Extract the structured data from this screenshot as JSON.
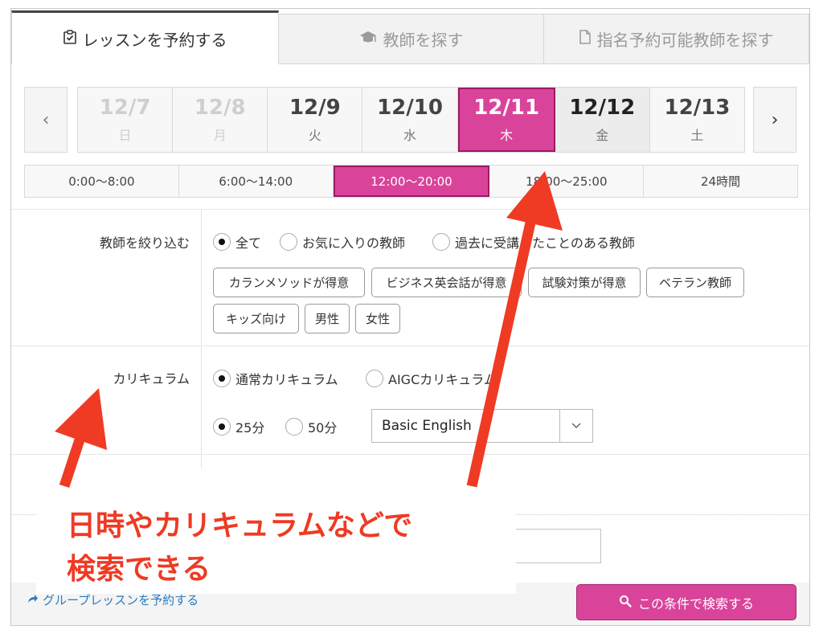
{
  "tabs": [
    {
      "label": "レッスンを予約する",
      "icon": "clipboard-check-icon"
    },
    {
      "label": "教師を探す",
      "icon": "graduation-cap-icon"
    },
    {
      "label": "指名予約可能教師を探す",
      "icon": "document-icon"
    }
  ],
  "nav": {
    "prev": "‹",
    "next": "›"
  },
  "dates": [
    {
      "date": "12/7",
      "weekday": "日"
    },
    {
      "date": "12/8",
      "weekday": "月"
    },
    {
      "date": "12/9",
      "weekday": "火"
    },
    {
      "date": "12/10",
      "weekday": "水"
    },
    {
      "date": "12/11",
      "weekday": "木"
    },
    {
      "date": "12/12",
      "weekday": "金"
    },
    {
      "date": "12/13",
      "weekday": "土"
    }
  ],
  "selected_date": "12/11",
  "time_slots": [
    "0:00〜8:00",
    "6:00〜14:00",
    "12:00〜20:00",
    "18:00〜25:00",
    "24時間"
  ],
  "selected_time_slot": "12:00〜20:00",
  "teacher_filter": {
    "label": "教師を絞り込む",
    "options": [
      "全て",
      "お気に入りの教師",
      "過去に受講したことのある教師"
    ],
    "selected": "全て",
    "tags": [
      "カランメソッドが得意",
      "ビジネス英会話が得意",
      "試験対策が得意",
      "ベテラン教師",
      "キッズ向け",
      "男性",
      "女性"
    ]
  },
  "curriculum": {
    "label": "カリキュラム",
    "options": [
      "通常カリキュラム",
      "AIGCカリキュラム"
    ],
    "selected": "通常カリキュラム",
    "durations": [
      "25分",
      "50分"
    ],
    "selected_duration": "25分",
    "course": "Basic English"
  },
  "annotation": {
    "line1": "日時やカリキュラムなどで",
    "line2": "検索できる",
    "color": "#ef3a24"
  },
  "footer": {
    "group_link": "グループレッスンを予約する",
    "search_button": "この条件で検索する"
  },
  "colors": {
    "accent": "#d9449a",
    "link": "#2a7bc0"
  }
}
